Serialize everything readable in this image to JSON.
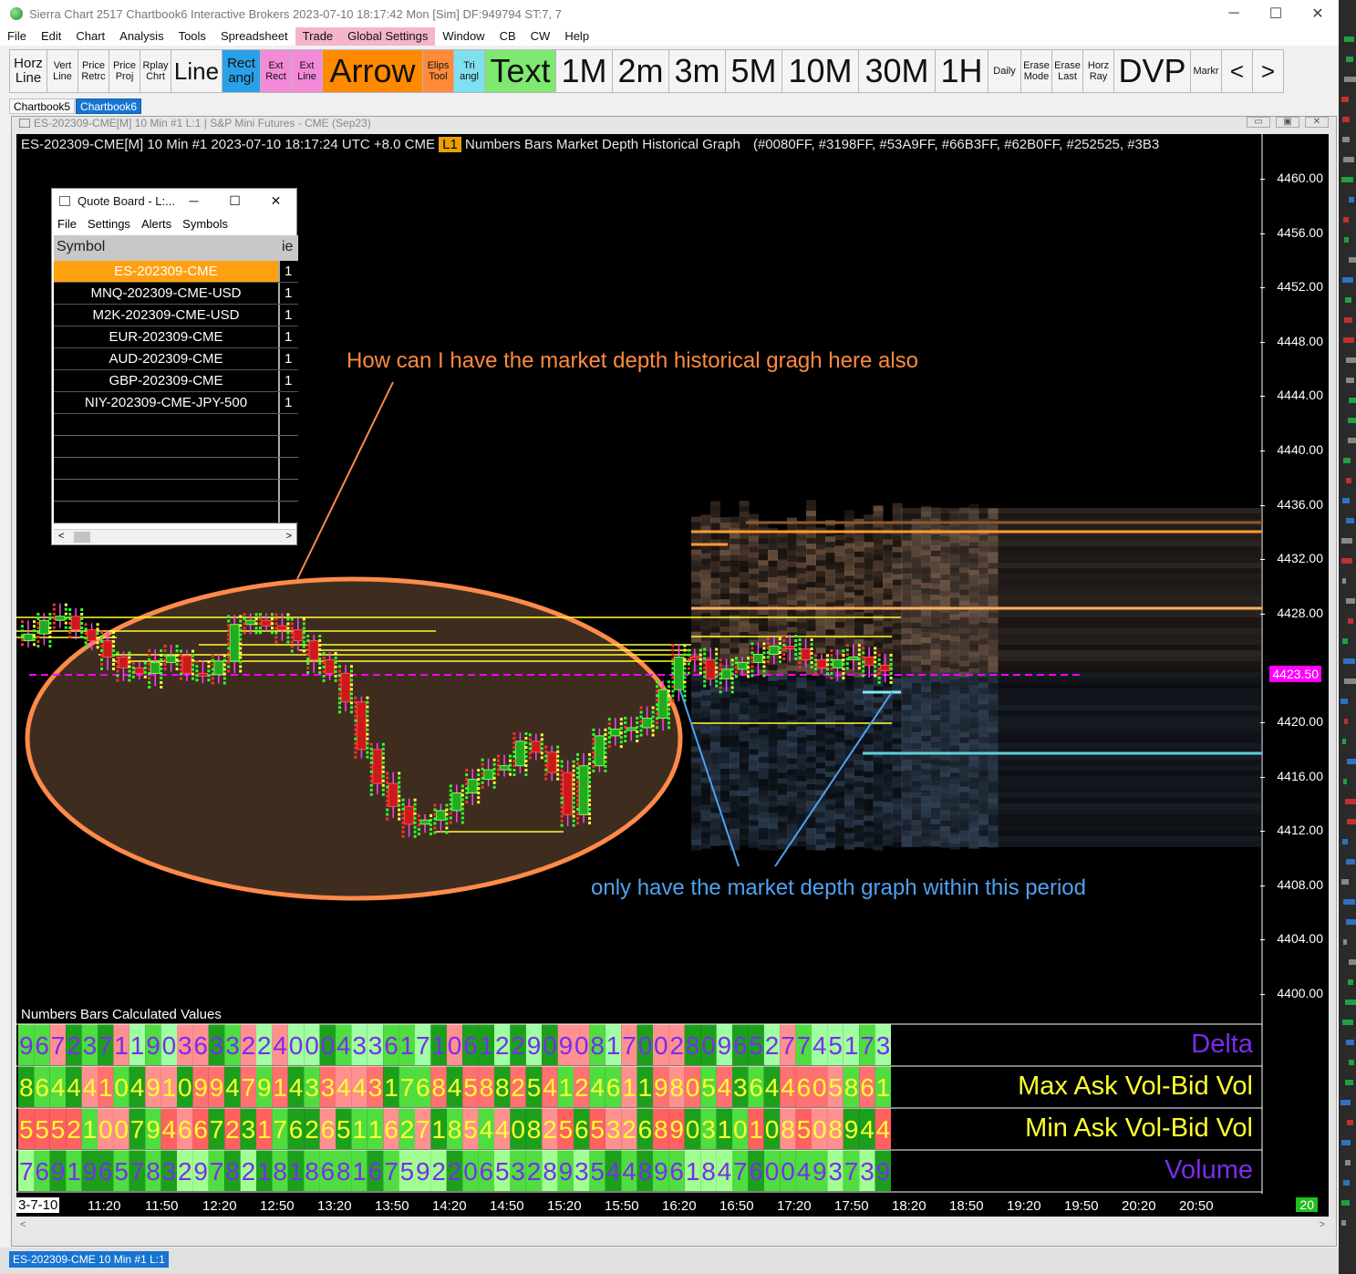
{
  "window": {
    "title": "Sierra Chart 2517 Chartbook6 Interactive Brokers 2023-07-10  18:17:42 Mon [Sim]  DF:949794  ST:7, 7",
    "minimize": "─",
    "maximize": "☐",
    "close": "✕"
  },
  "menu": [
    "File",
    "Edit",
    "Chart",
    "Analysis",
    "Tools",
    "Spreadsheet",
    "Trade",
    "Global Settings",
    "Window",
    "CB",
    "CW",
    "Help"
  ],
  "menu_highlight_colors": {
    "Trade": "#f4b4cc",
    "Global Settings": "#f4b4cc"
  },
  "toolbar": [
    {
      "label": "Horz\nLine",
      "size": "lg2",
      "bg": "#f4f4f4"
    },
    {
      "label": "Vert\nLine",
      "size": "sm",
      "bg": "#f4f4f4"
    },
    {
      "label": "Price\nRetrc",
      "size": "sm",
      "bg": "#f4f4f4"
    },
    {
      "label": "Price\nProj",
      "size": "sm",
      "bg": "#f4f4f4"
    },
    {
      "label": "Rplay\nChrt",
      "size": "sm",
      "bg": "#f4f4f4"
    },
    {
      "label": "Line",
      "size": "xl",
      "bg": "#f4f4f4"
    },
    {
      "label": "Rect\nangl",
      "size": "lg2",
      "bg": "#2aa0e8"
    },
    {
      "label": "Ext\nRect",
      "size": "sm",
      "bg": "#f28ad8"
    },
    {
      "label": "Ext\nLine",
      "size": "sm",
      "bg": "#f28ad8"
    },
    {
      "label": "Arrow",
      "size": "xxl",
      "bg": "#ff8a00"
    },
    {
      "label": "Elips\nTool",
      "size": "sm",
      "bg": "#ff8a3a"
    },
    {
      "label": "Tri\nangl",
      "size": "sm",
      "bg": "#7fe0f0"
    },
    {
      "label": "Text",
      "size": "xxl",
      "bg": "#7fe870"
    },
    {
      "label": "1M",
      "size": "xxl",
      "bg": "#f4f4f4"
    },
    {
      "label": "2m",
      "size": "xxl",
      "bg": "#f4f4f4"
    },
    {
      "label": "3m",
      "size": "xxl",
      "bg": "#f4f4f4"
    },
    {
      "label": "5M",
      "size": "xxl",
      "bg": "#f4f4f4"
    },
    {
      "label": "10M",
      "size": "xxl",
      "bg": "#f4f4f4"
    },
    {
      "label": "30M",
      "size": "xxl",
      "bg": "#f4f4f4"
    },
    {
      "label": "1H",
      "size": "xxl",
      "bg": "#f4f4f4"
    },
    {
      "label": "Daily",
      "size": "sm",
      "bg": "#f4f4f4"
    },
    {
      "label": "Erase\nMode",
      "size": "sm",
      "bg": "#f4f4f4"
    },
    {
      "label": "Erase\nLast",
      "size": "sm",
      "bg": "#f4f4f4"
    },
    {
      "label": "Horz\nRay",
      "size": "sm",
      "bg": "#f4f4f4"
    },
    {
      "label": "DVP",
      "size": "xxl",
      "bg": "#f4f4f4"
    },
    {
      "label": "Markr",
      "size": "sm",
      "bg": "#f4f4f4"
    },
    {
      "label": "<",
      "size": "xl",
      "bg": "#f4f4f4"
    },
    {
      "label": ">",
      "size": "xl",
      "bg": "#f4f4f4"
    }
  ],
  "chartbook_tabs": [
    {
      "label": "Chartbook5",
      "active": false
    },
    {
      "label": "Chartbook6",
      "active": true
    }
  ],
  "chart_window": {
    "title": "ES-202309-CME[M]  10 Min  #1 L:1 | S&P Mini Futures - CME (Sep23)",
    "buttons": [
      "▭",
      "▣",
      "✕"
    ]
  },
  "chart": {
    "header_symbol": "ES-202309-CME[M]  10 Min  #1 2023-07-10 18:17:24 UTC +8.0 CME",
    "header_badge": "L1",
    "header_studies": "Numbers Bars  Market Depth Historical Graph",
    "header_colors": "(#0080FF, #3198FF, #53A9FF, #66B3FF, #62B0FF, #252525, #3B3",
    "y_axis_labels": [
      "4460.00",
      "4456.00",
      "4452.00",
      "4448.00",
      "4444.00",
      "4440.00",
      "4436.00",
      "4432.00",
      "4428.00",
      "4420.00",
      "4416.00",
      "4412.00",
      "4408.00",
      "4404.00",
      "4400.00"
    ],
    "last_price": "4423.50",
    "x_axis_date": "3-7-10",
    "x_axis_labels": [
      "11:20",
      "11:50",
      "12:20",
      "12:50",
      "13:20",
      "13:50",
      "14:20",
      "14:50",
      "15:20",
      "15:50",
      "16:20",
      "16:50",
      "17:20",
      "17:50",
      "18:20",
      "18:50",
      "19:20",
      "19:50",
      "20:20",
      "20:50"
    ],
    "bar_count": "20",
    "numbers_bars_title": "Numbers Bars Calculated Values",
    "numbers_bars_rows": [
      {
        "label": "Delta",
        "color": "#7b2cf0"
      },
      {
        "label": "Max Ask Vol-Bid Vol",
        "color": "#ffff30"
      },
      {
        "label": "Min Ask Vol-Bid Vol",
        "color": "#ffff30"
      },
      {
        "label": "Volume",
        "color": "#7b2cf0"
      }
    ]
  },
  "quote_board": {
    "title": "Quote Board - L:...",
    "menu": [
      "File",
      "Settings",
      "Alerts",
      "Symbols"
    ],
    "col_symbol": "Symbol",
    "col_2": "ie",
    "rows": [
      {
        "symbol": "ES-202309-CME",
        "val": "1",
        "selected": true
      },
      {
        "symbol": "MNQ-202309-CME-USD",
        "val": "1",
        "selected": false
      },
      {
        "symbol": "M2K-202309-CME-USD",
        "val": "1",
        "selected": false
      },
      {
        "symbol": "EUR-202309-CME",
        "val": "1",
        "selected": false
      },
      {
        "symbol": "AUD-202309-CME",
        "val": "1",
        "selected": false
      },
      {
        "symbol": "GBP-202309-CME",
        "val": "1",
        "selected": false
      },
      {
        "symbol": "NIY-202309-CME-JPY-500",
        "val": "1",
        "selected": false
      }
    ],
    "empty_rows": 5
  },
  "annotations": {
    "question": "How can I  have the market depth historical gragh here also",
    "note": "only have the market depth graph within this period"
  },
  "status_bar": "ES-202309-CME  10 Min  #1 L:1",
  "colors": {
    "ellipse_fill": "#3e2d1f",
    "ellipse_stroke": "#ff8a4a",
    "annot_orange": "#ff8a3d",
    "annot_blue": "#4fa2f0",
    "last_price_line": "#ff00ff",
    "level_line": "#ffff30"
  }
}
